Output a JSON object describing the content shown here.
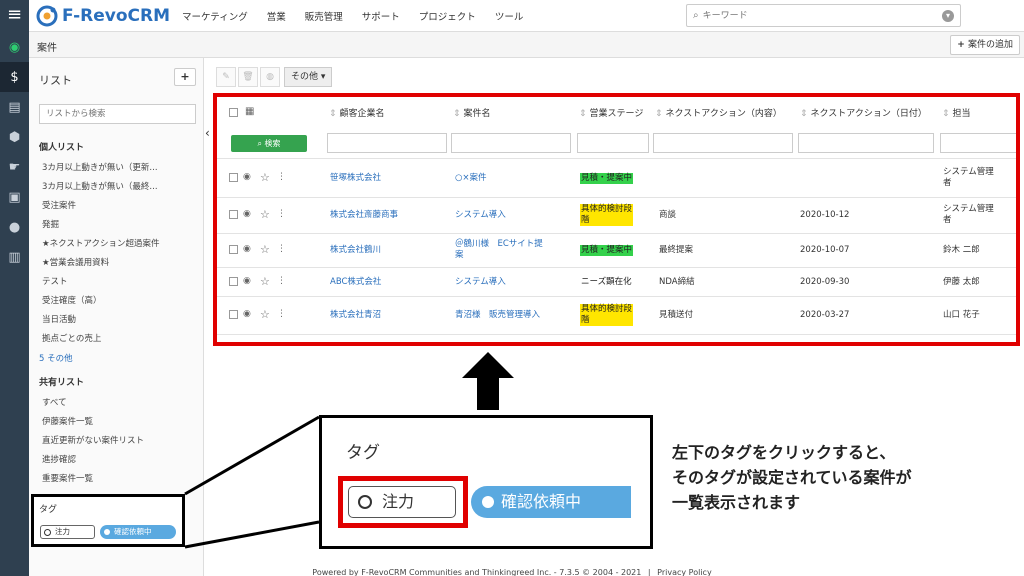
{
  "brand": {
    "name": "F-RevoCRM",
    "logo_color": "#2a6fbc"
  },
  "nav": [
    "マーケティング",
    "営業",
    "販売管理",
    "サポート",
    "プロジェクト",
    "ツール"
  ],
  "search": {
    "placeholder": "キーワード"
  },
  "rail_icons": [
    "dashboard-icon",
    "money-bag-icon",
    "contacts-icon",
    "cube-icon",
    "handshake-icon",
    "calendar-icon",
    "user-icon",
    "building-icon"
  ],
  "module_title": "案件",
  "add_case_button": "案件の追加",
  "sidebar": {
    "title": "リスト",
    "add": "+",
    "search_placeholder": "リストから検索",
    "personal_heading": "個人リスト",
    "personal_items": [
      "3カ月以上動きが無い（更新...",
      "3カ月以上動きが無い（最終...",
      "受注案件",
      "発掘",
      "★ネクストアクション超過案件",
      "★営業会議用資料",
      "テスト",
      "受注確度（高）",
      "当日活動",
      "拠点ごとの売上"
    ],
    "more": "5 その他",
    "shared_heading": "共有リスト",
    "shared_items": [
      "すべて",
      "伊藤案件一覧",
      "直近更新がない案件リスト",
      "進捗確認",
      "重要案件一覧"
    ],
    "tag_heading": "タグ",
    "tags": [
      "注力",
      "確認依頼中"
    ]
  },
  "toolbar": {
    "more": "その他"
  },
  "table": {
    "columns": [
      "顧客企業名",
      "案件名",
      "営業ステージ",
      "ネクストアクション（内容）",
      "ネクストアクション（日付）",
      "担当"
    ],
    "search_button": "検索",
    "rows": [
      {
        "company": "笹塚株式会社",
        "case": "○×案件",
        "case2": "",
        "stage": "見積・提案中",
        "stage2": "",
        "stage_color": "green",
        "action": "",
        "date": "",
        "owner": "システム管理",
        "owner2": "者"
      },
      {
        "company": "株式会社斎藤商事",
        "case": "システム導入",
        "case2": "",
        "stage": "具体的検討段",
        "stage2": "階",
        "stage_color": "yellow",
        "action": "商談",
        "date": "2020-10-12",
        "owner": "システム管理",
        "owner2": "者"
      },
      {
        "company": "株式会社鶴川",
        "case": "＠鶴川様　ECサイト提",
        "case2": "案",
        "stage": "見積・提案中",
        "stage2": "",
        "stage_color": "green",
        "action": "最終提案",
        "date": "2020-10-07",
        "owner": "鈴木 二郎",
        "owner2": ""
      },
      {
        "company": "ABC株式会社",
        "case": "システム導入",
        "case2": "",
        "stage": "ニーズ顕在化",
        "stage2": "",
        "stage_color": "none",
        "action": "NDA締結",
        "date": "2020-09-30",
        "owner": "伊藤 太郎",
        "owner2": ""
      },
      {
        "company": "株式会社青沼",
        "case": "青沼様　販売管理導入",
        "case2": "",
        "stage": "具体的検討段",
        "stage2": "階",
        "stage_color": "yellow",
        "action": "見積送付",
        "date": "2020-03-27",
        "owner": "山口 花子",
        "owner2": ""
      }
    ],
    "right_edge": [
      "0",
      "0",
      "2",
      "0",
      "3"
    ]
  },
  "zoom": {
    "title": "タグ",
    "tags": [
      "注力",
      "確認依頼中"
    ]
  },
  "explanation": [
    "左下のタグをクリックすると、",
    "そのタグが設定されている案件が",
    "一覧表示されます"
  ],
  "footer": [
    "Powered by F-RevoCRM Communities and Thinkingreed Inc. - 7.3.5  © 2004 - 2021",
    "|",
    "Privacy Policy"
  ],
  "colors": {
    "highlight": "#e00000",
    "green_stage": "#34d14b",
    "yellow_stage": "#ffe600",
    "tag_blue": "#5aa9e0",
    "rail": "#2f4050"
  }
}
